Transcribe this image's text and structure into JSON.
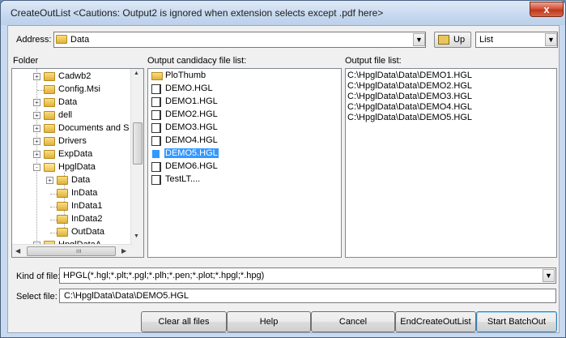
{
  "window": {
    "title": "CreateOutList <Cautions: Output2 is ignored when extension selects except .pdf here>",
    "close_label": "x"
  },
  "address": {
    "label": "Address:",
    "value": "Data",
    "up_label": "Up",
    "view_value": "List"
  },
  "headers": {
    "folder": "Folder",
    "candidate": "Output candidacy file list:",
    "output": "Output file list:"
  },
  "folder_tree": [
    {
      "label": "Cadwb2",
      "expander": "+"
    },
    {
      "label": "Config.Msi",
      "expander": ""
    },
    {
      "label": "Data",
      "expander": "+"
    },
    {
      "label": "dell",
      "expander": "+"
    },
    {
      "label": "Documents and S",
      "expander": "+"
    },
    {
      "label": "Drivers",
      "expander": "+"
    },
    {
      "label": "ExpData",
      "expander": "+"
    },
    {
      "label": "HpglData",
      "expander": "-"
    },
    {
      "label": "Data",
      "expander": "+"
    },
    {
      "label": "InData",
      "expander": ""
    },
    {
      "label": "InData1",
      "expander": ""
    },
    {
      "label": "InData2",
      "expander": ""
    },
    {
      "label": "OutData",
      "expander": ""
    },
    {
      "label": "HpglDataA",
      "expander": "+"
    }
  ],
  "candidate_files": [
    {
      "label": "PloThumb",
      "type": "folder"
    },
    {
      "label": "DEMO.HGL",
      "type": "file"
    },
    {
      "label": "DEMO1.HGL",
      "type": "file"
    },
    {
      "label": "DEMO2.HGL",
      "type": "file"
    },
    {
      "label": "DEMO3.HGL",
      "type": "file"
    },
    {
      "label": "DEMO4.HGL",
      "type": "file"
    },
    {
      "label": "DEMO5.HGL",
      "type": "file",
      "selected": true
    },
    {
      "label": "DEMO6.HGL",
      "type": "file"
    },
    {
      "label": "TestLT....",
      "type": "file"
    }
  ],
  "output_files": [
    "C:\\HpglData\\Data\\DEMO1.HGL",
    "C:\\HpglData\\Data\\DEMO2.HGL",
    "C:\\HpglData\\Data\\DEMO3.HGL",
    "C:\\HpglData\\Data\\DEMO4.HGL",
    "C:\\HpglData\\Data\\DEMO5.HGL"
  ],
  "kind": {
    "label": "Kind of file:",
    "value": "HPGL(*.hgl;*.plt;*.pgl;*.plh;*.pen;*.plot;*.hpgl;*.hpg)"
  },
  "select": {
    "label": "Select file:",
    "value": "C:\\HpglData\\Data\\DEMO5.HGL"
  },
  "buttons": {
    "clear": "Clear all files",
    "help": "Help",
    "cancel": "Cancel",
    "end": "EndCreateOutList",
    "start": "Start BatchOut"
  },
  "colors": {
    "selection": "#3399ff",
    "title_bg": "#c6d8ef",
    "close": "#c0361d"
  }
}
